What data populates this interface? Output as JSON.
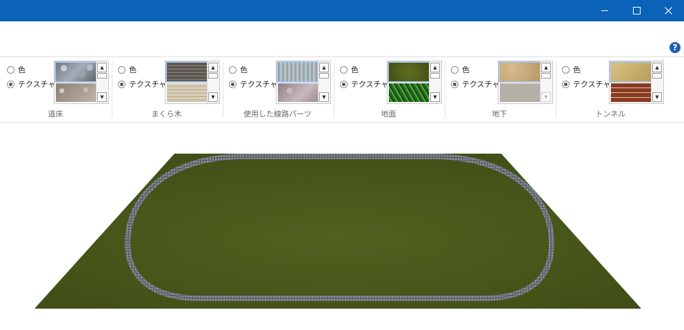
{
  "window": {
    "controls": {
      "minimize": "minimize-icon",
      "maximize": "maximize-icon",
      "close": "close-icon"
    }
  },
  "help": {
    "label": "?"
  },
  "ribbon": {
    "groups": [
      {
        "label": "道床",
        "color_option": "色",
        "texture_option": "テクスチャ",
        "selected": "texture",
        "swatches": [
          "ballast-texture",
          "gravel-texture"
        ],
        "scroll_down_enabled": true
      },
      {
        "label": "まくら木",
        "color_option": "色",
        "texture_option": "テクスチャ",
        "selected": "texture",
        "swatches": [
          "dark-wood-texture",
          "light-wood-texture"
        ],
        "scroll_down_enabled": true
      },
      {
        "label": "使用した線路パーツ",
        "color_option": "色",
        "texture_option": "テクスチャ",
        "selected": "texture",
        "swatches": [
          "metal-texture",
          "granite-texture"
        ],
        "scroll_down_enabled": true
      },
      {
        "label": "地面",
        "color_option": "色",
        "texture_option": "テクスチャ",
        "selected": "texture",
        "swatches": [
          "grass-texture",
          "leaves-texture"
        ],
        "scroll_down_enabled": true
      },
      {
        "label": "地下",
        "color_option": "色",
        "texture_option": "テクスチャ",
        "selected": "texture",
        "swatches": [
          "sand-texture",
          "concrete-texture"
        ],
        "scroll_down_enabled": false
      },
      {
        "label": "トンネル",
        "color_option": "色",
        "texture_option": "テクスチャ",
        "selected": "texture",
        "swatches": [
          "yellow-stone-texture",
          "brick-texture"
        ],
        "scroll_down_enabled": true
      }
    ]
  },
  "scene": {
    "ground_color": "#4b5a1d",
    "track_color": "#6f7480",
    "shape": "oval-track-on-ground-plane"
  }
}
